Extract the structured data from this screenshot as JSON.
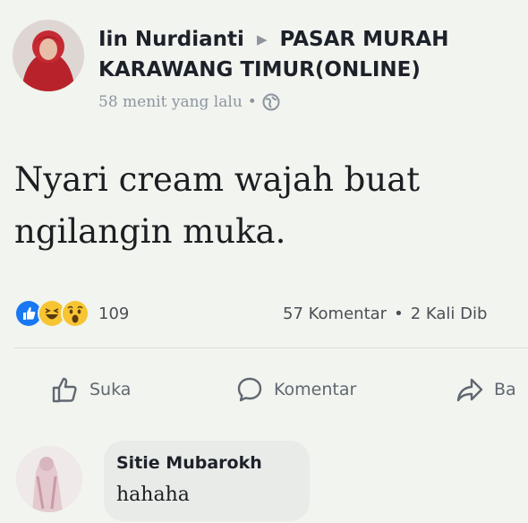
{
  "post": {
    "author": "Iin Nurdianti",
    "group": "PASAR MURAH KARAWANG TIMUR(ONLINE)",
    "time": "58 menit yang lalu",
    "separator": "•",
    "text_line1": "Nyari cream wajah buat",
    "text_line2": "ngilangin muka."
  },
  "stats": {
    "reactions": [
      "like-icon",
      "haha-icon",
      "wow-icon"
    ],
    "reaction_count": "109",
    "comments": "57 Komentar",
    "dot": "•",
    "shares": "2 Kali Dib"
  },
  "actions": {
    "like": "Suka",
    "comment": "Komentar",
    "share": "Ba"
  },
  "comment": {
    "author": "Sitie Mubarokh",
    "text": "hahaha"
  },
  "colors": {
    "like_blue": "#1877f2",
    "emoji_yellow": "#f7c531",
    "meta_gray": "#8d949e"
  }
}
